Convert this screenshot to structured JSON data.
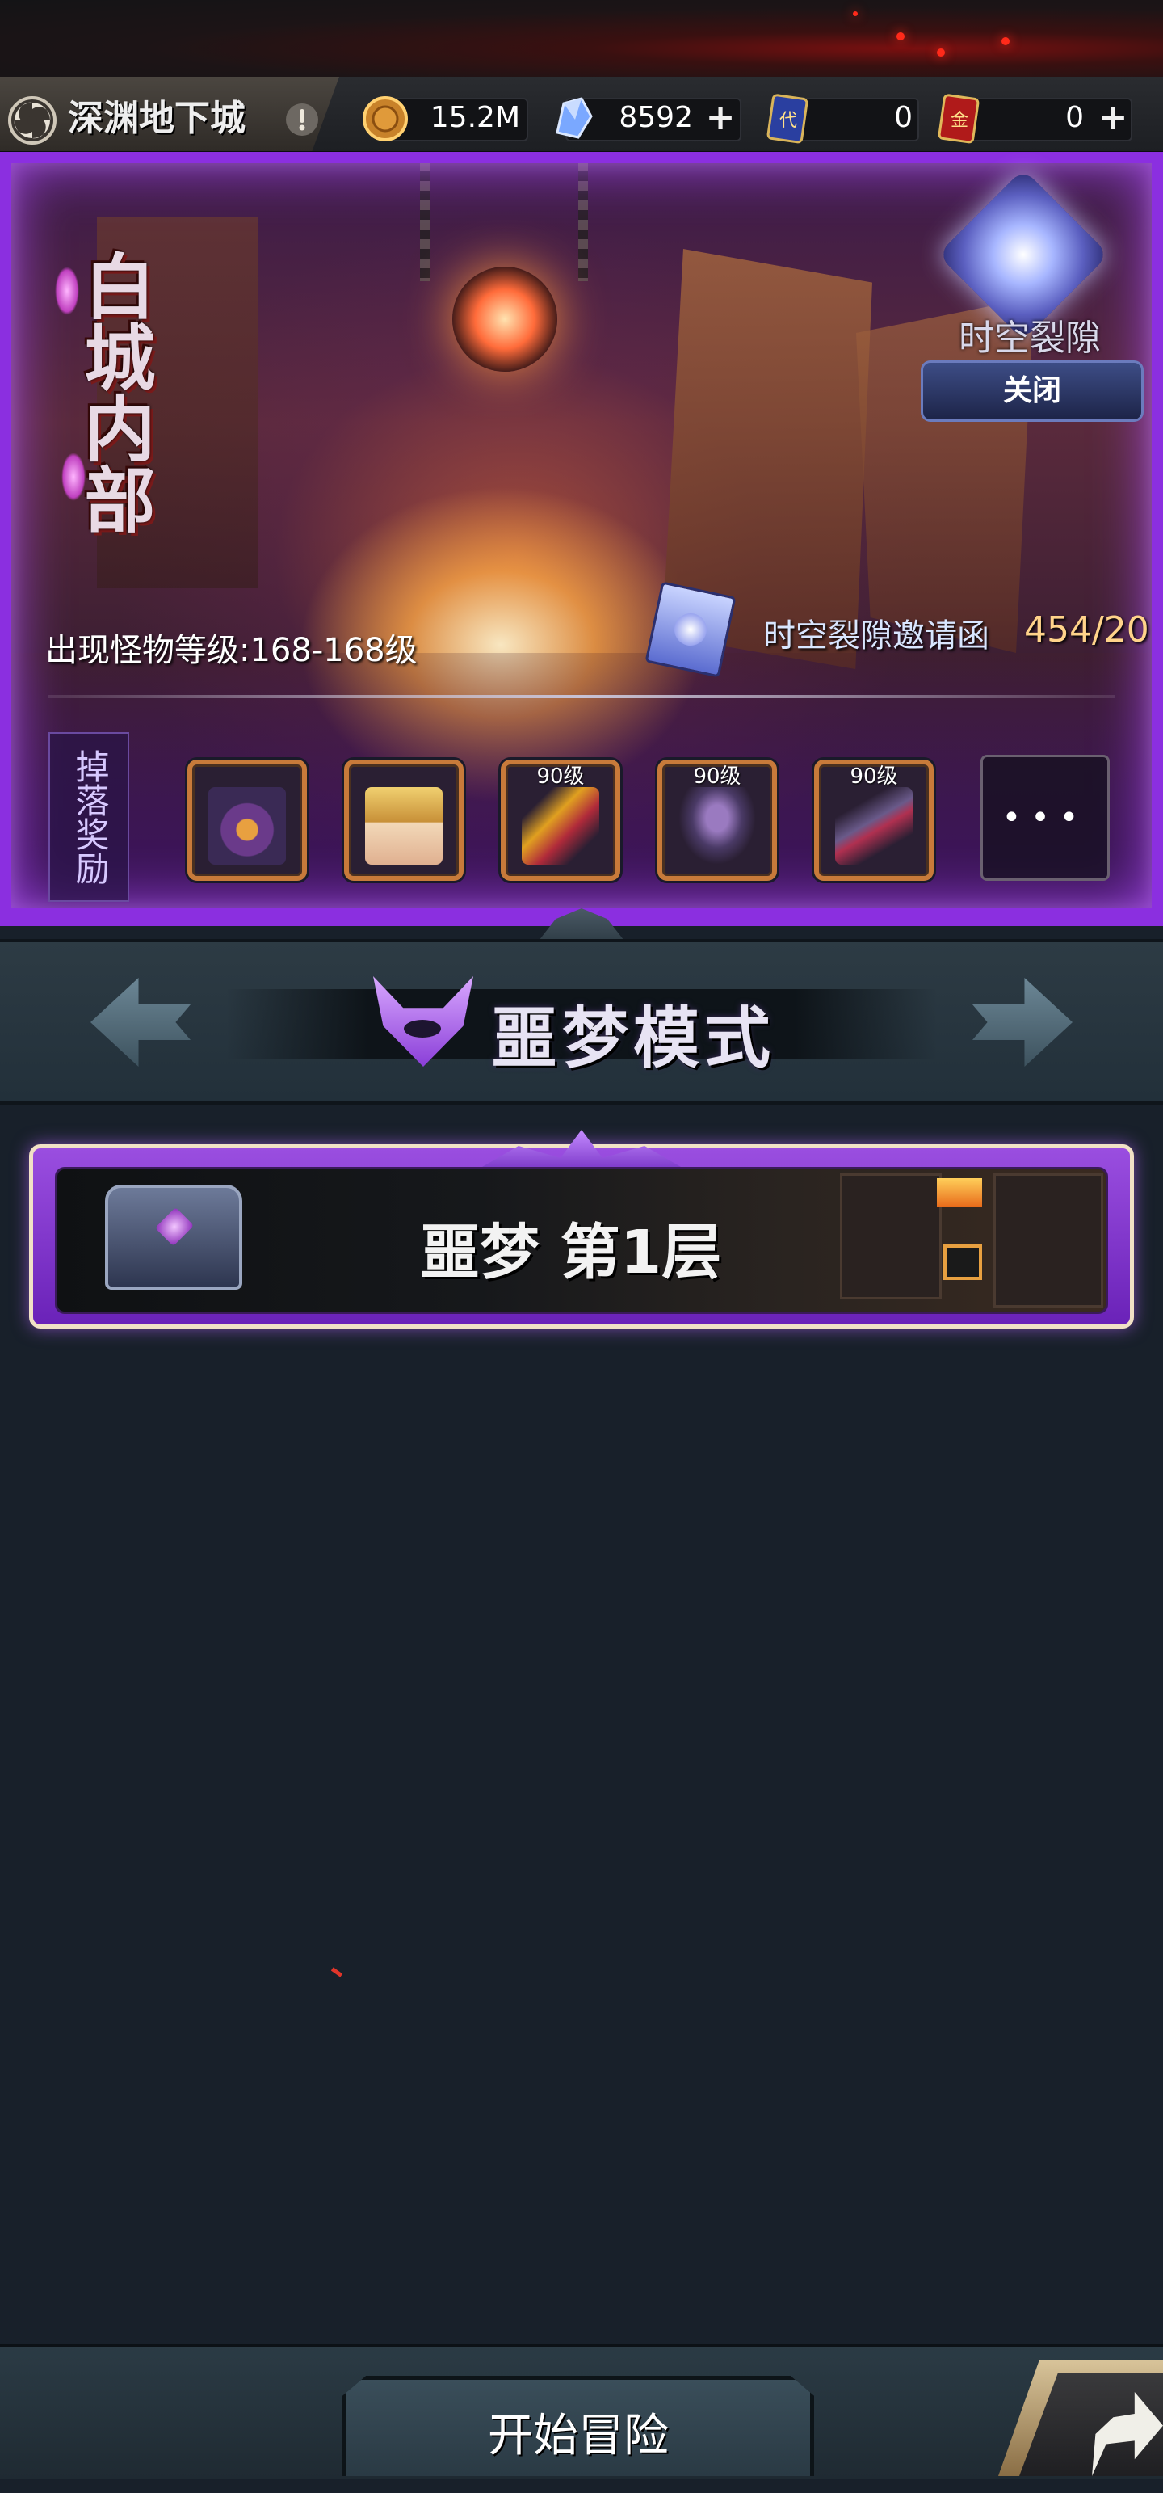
{
  "header": {
    "location_name": "深渊地下城",
    "alert_icon": "exclamation-icon",
    "resources": [
      {
        "icon": "gold-coin-icon",
        "value": "15.2M",
        "has_plus": false
      },
      {
        "icon": "blue-crystal-icon",
        "value": "8592",
        "has_plus": true
      },
      {
        "icon": "blue-ticket-icon",
        "value": "0",
        "has_plus": false
      },
      {
        "icon": "gold-ticket-icon",
        "value": "0",
        "has_plus": true
      }
    ],
    "plus_symbol": "+"
  },
  "banner": {
    "dungeon_name": "白城内部",
    "rift_label": "时空裂隙",
    "close_label": "关闭",
    "monster_level": "出现怪物等级:168-168级",
    "invite_label": "时空裂隙邀请函",
    "invite_count": "454/20",
    "drop_label": "掉落奖励",
    "rewards": [
      {
        "icon": "one-eyed-demon-icon",
        "level": ""
      },
      {
        "icon": "blonde-elf-portrait-icon",
        "level": ""
      },
      {
        "icon": "flame-claw-weapon-icon",
        "level": "90级"
      },
      {
        "icon": "dark-armor-icon",
        "level": "90级"
      },
      {
        "icon": "dark-blade-weapon-icon",
        "level": "90级"
      }
    ],
    "more_label": "•••"
  },
  "mode": {
    "name": "噩梦模式",
    "icon": "horned-demon-icon"
  },
  "floor": {
    "label": "噩梦 第1层",
    "icon": "treasure-chest-icon"
  },
  "footer": {
    "start_label": "开始冒险",
    "next_icon": "share-arrow-icon"
  },
  "colors": {
    "accent_purple": "#8b2fe0",
    "background": "#18202a",
    "gold_text": "#ffd38a"
  }
}
